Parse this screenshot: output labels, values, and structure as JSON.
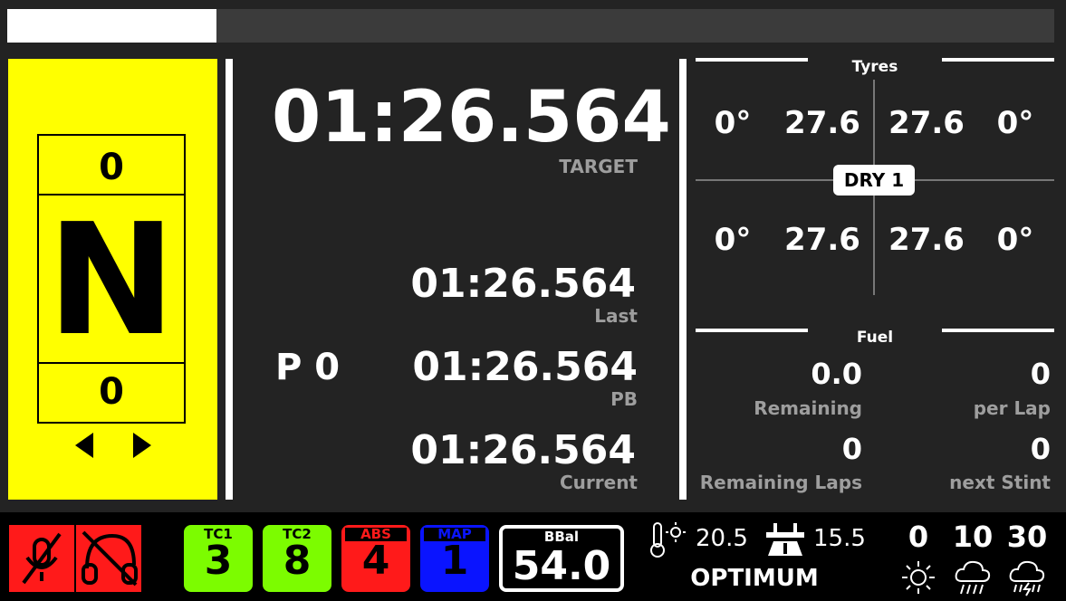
{
  "progress": {
    "fill_fraction": 0.2,
    "track_color": "#3b3b3b",
    "fill_color": "#ffffff"
  },
  "gear": {
    "panel_color": "#ffff00",
    "top_value": "0",
    "gear": "N",
    "bottom_value": "0",
    "left_arrow_icon": "arrow-left-icon",
    "right_arrow_icon": "arrow-right-icon"
  },
  "timing": {
    "target": {
      "time": "01:26.564",
      "label": "TARGET"
    },
    "last": {
      "time": "01:26.564",
      "label": "Last"
    },
    "pb": {
      "time": "01:26.564",
      "label": "PB"
    },
    "current": {
      "time": "01:26.564",
      "label": "Current"
    },
    "position": "P 0"
  },
  "tyres": {
    "title": "Tyres",
    "front": [
      "0°",
      "27.6",
      "27.6",
      "0°"
    ],
    "rear": [
      "0°",
      "27.6",
      "27.6",
      "0°"
    ],
    "compound": "DRY 1"
  },
  "fuel": {
    "title": "Fuel",
    "remaining": {
      "value": "0.0",
      "label": "Remaining"
    },
    "per_lap": {
      "value": "0",
      "label": "per Lap"
    },
    "remaining_laps": {
      "value": "0",
      "label": "Remaining Laps"
    },
    "next_stint": {
      "value": "0",
      "label": "next Stint"
    }
  },
  "bottom": {
    "mic_off_icon": "mic-off-icon",
    "radio_off_icon": "headset-off-icon",
    "tc1": {
      "label": "TC1",
      "value": "3",
      "color": "#7cfc00"
    },
    "tc2": {
      "label": "TC2",
      "value": "8",
      "color": "#7cfc00"
    },
    "abs": {
      "label": "ABS",
      "value": "4",
      "color": "#ff1a1a"
    },
    "map": {
      "label": "MAP",
      "value": "1",
      "color": "#0a14ff"
    },
    "bbal": {
      "label": "BBal",
      "value": "54.0"
    },
    "air_temp": {
      "icon": "thermometer-sun-icon",
      "value": "20.5"
    },
    "track_temp": {
      "icon": "road-icon",
      "value": "15.5"
    },
    "track_state": "OPTIMUM",
    "weather": [
      {
        "value": "0",
        "icon": "sun-icon"
      },
      {
        "value": "10",
        "icon": "rain-cloud-icon"
      },
      {
        "value": "30",
        "icon": "storm-cloud-icon"
      }
    ]
  }
}
